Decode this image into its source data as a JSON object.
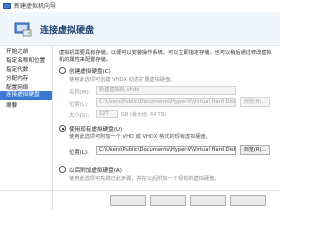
{
  "window": {
    "title": "新建虚拟机向导"
  },
  "header": {
    "title": "连接虚拟硬盘"
  },
  "sidebar": {
    "items": [
      {
        "label": "开始之前"
      },
      {
        "label": "指定名称和位置"
      },
      {
        "label": "指定代数"
      },
      {
        "label": "分配内存"
      },
      {
        "label": "配置网络"
      },
      {
        "label": "连接虚拟硬盘"
      },
      {
        "label": "摘要"
      }
    ]
  },
  "main": {
    "intro": "虚拟机需要具有存储，以便可以安装操作系统。可以立即指定存储，也可以稍后通过修改虚拟机的属性来配置存储。",
    "option_create": {
      "label": "创建虚拟硬盘(C)",
      "desc": "使用此选项可创建 VHDX 动态扩展虚拟硬盘。",
      "name_label": "名称(M):",
      "name_value": "新建虚拟机.vhdx",
      "location_label": "位置(L):",
      "location_value": "C:\\Users\\Public\\Documents\\Hyper-V\\Virtual Hard Disks\\",
      "browse_label": "浏览(B)...",
      "size_label": "大小(S):",
      "size_value": "127",
      "size_note": "GB (最大值: 64 TB)"
    },
    "option_existing": {
      "label": "使用现有虚拟硬盘(U)",
      "desc": "使用此选项可附加一个 VHD 或 VHDX 格式的现有虚拟硬盘。",
      "location_label": "位置(L):",
      "location_value": "C:\\Users\\Public\\Documents\\Hyper-V\\Virtual Hard Disks\\",
      "browse_label": "浏览(R)...",
      "selected": true
    },
    "option_later": {
      "label": "以后附加虚拟硬盘(A)",
      "desc": "使用此选项可先跳过此步骤，并在以后附加一个现有的虚拟硬盘。"
    }
  }
}
